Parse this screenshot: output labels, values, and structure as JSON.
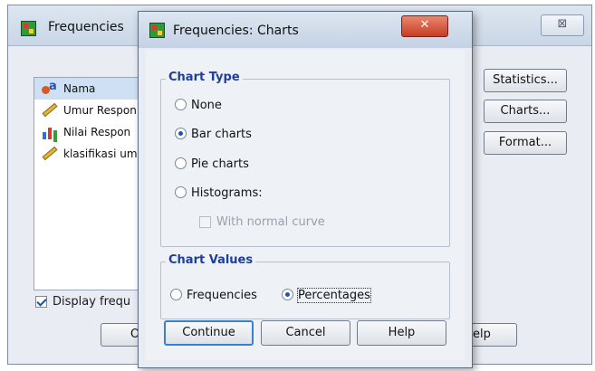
{
  "background_window": {
    "title": "Frequencies",
    "close_glyph": "⊠",
    "variables": [
      {
        "label": "Nama",
        "icon": "nominal-variable-icon",
        "selected": true
      },
      {
        "label": "Umur Respon",
        "icon": "scale-variable-icon",
        "selected": false
      },
      {
        "label": "Nilai Respon",
        "icon": "ordinal-variable-icon",
        "selected": false
      },
      {
        "label": "klasifikasi um",
        "icon": "scale-variable-icon",
        "selected": false
      }
    ],
    "display_frequency_label": "Display frequ",
    "display_frequency_checked": true,
    "buttons": {
      "statistics": "Statistics...",
      "charts": "Charts...",
      "format": "Format...",
      "ok_partial": "O",
      "help_partial": "elp"
    }
  },
  "dialog": {
    "title": "Frequencies: Charts",
    "close_glyph": "✕",
    "chart_type": {
      "title": "Chart Type",
      "options": [
        {
          "label": "None",
          "selected": false
        },
        {
          "label": "Bar charts",
          "selected": true
        },
        {
          "label": "Pie charts",
          "selected": false
        },
        {
          "label": "Histograms:",
          "selected": false
        }
      ],
      "normal_curve_label": "With normal curve",
      "normal_curve_enabled": false
    },
    "chart_values": {
      "title": "Chart Values",
      "options": [
        {
          "label": "Frequencies",
          "selected": false
        },
        {
          "label": "Percentages",
          "selected": true
        }
      ]
    },
    "buttons": {
      "continue": "Continue",
      "cancel": "Cancel",
      "help": "Help"
    }
  },
  "colors": {
    "group_title": "#1e3f9a",
    "selection": "#cfe0f5",
    "close_button": "#c63d22"
  }
}
